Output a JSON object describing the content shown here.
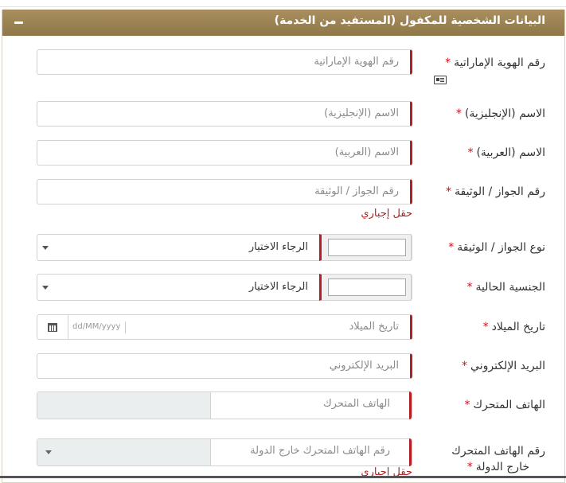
{
  "panel": {
    "title": "البيانات الشخصية للمكفول (المستفيد من الخدمة)"
  },
  "fields": {
    "emirates_id": {
      "label": "رقم الهوية الإماراتية",
      "placeholder": "رقم الهوية الإماراتية"
    },
    "name_en": {
      "label": "الاسم (الإنجليزية)",
      "placeholder": "الاسم (الإنجليزية)"
    },
    "name_ar": {
      "label": "الاسم (العربية)",
      "placeholder": "الاسم (العربية)"
    },
    "passport_no": {
      "label": "رقم الجواز / الوثيقة",
      "placeholder": "رقم الجواز / الوثيقة",
      "error": "حقل إجباري"
    },
    "passport_type": {
      "label": "نوع الجواز / الوثيقة",
      "selected": "الرجاء الاختيار"
    },
    "nationality": {
      "label": "الجنسية الحالية",
      "selected": "الرجاء الاختيار"
    },
    "birth_date": {
      "label": "تاريخ الميلاد",
      "placeholder": "تاريخ الميلاد",
      "format": "dd/MM/yyyy"
    },
    "email": {
      "label": "البريد الإلكتروني",
      "placeholder": "البريد الإلكتروني"
    },
    "mobile": {
      "label": "الهاتف المتحرك",
      "placeholder": "الهاتف المتحرك"
    },
    "mobile_abroad": {
      "label_line1": "رقم الهاتف المتحرك",
      "label_line2": "خارج الدولة",
      "placeholder": "رقم الهاتف المتحرك خارج الدولة",
      "error": "حقل إجباري"
    }
  },
  "required_mark": "*",
  "icons": {
    "collapse": "minus-icon",
    "id_card": "id-card-icon",
    "calendar": "calendar-icon",
    "dropdown": "caret-down-icon"
  },
  "colors": {
    "header_bg": "#9c8352",
    "required": "#c0171d",
    "error": "#b21f24",
    "disabled_bg": "#eaeeef"
  }
}
